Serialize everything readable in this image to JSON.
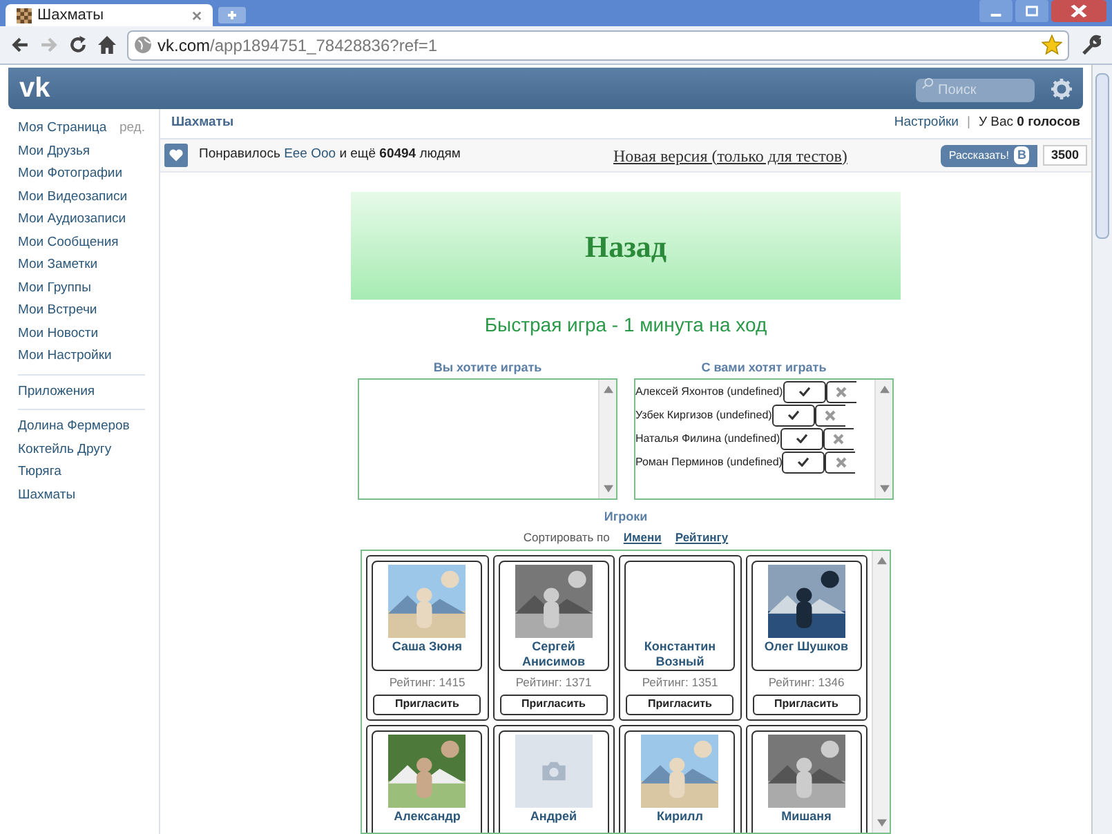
{
  "browser": {
    "tab_title": "Шахматы",
    "url_host": "vk.com",
    "url_path": "/app1894751_78428836?ref=1"
  },
  "header": {
    "logo": "vk",
    "search_placeholder": "Поиск"
  },
  "sidebar": {
    "edit_link": "ред.",
    "groups": [
      {
        "items": [
          "Моя Страница",
          "Мои Друзья",
          "Мои Фотографии",
          "Мои Видеозаписи",
          "Мои Аудиозаписи",
          "Мои Сообщения",
          "Мои Заметки",
          "Мои Группы",
          "Мои Встречи",
          "Мои Новости",
          "Мои Настройки"
        ]
      },
      {
        "items": [
          "Приложения"
        ]
      },
      {
        "items": [
          "Долина Фермеров",
          "Коктейль Другу",
          "Тюряга",
          "Шахматы"
        ]
      }
    ]
  },
  "app_bar": {
    "title": "Шахматы",
    "settings": "Настройки",
    "separator": "|",
    "votes": "У Вас **0 голосов**"
  },
  "like_bar": {
    "liked": "Понравилось ",
    "friend": "Еее Ооо",
    "rest": " и ещё **60494** людям",
    "new_version": "Новая версия (только для тестов)",
    "share": "Рассказать!",
    "vk_badge": "В",
    "count": "3500"
  },
  "game": {
    "back": "Назад",
    "mode": "Быстрая игра - 1 минута на ход",
    "you_want": {
      "title": "Вы хотите играть"
    },
    "want_you": {
      "title": "С вами хотят играть",
      "requests": [
        {
          "name": "Алексей Яхонтов (undefined)"
        },
        {
          "name": "Узбек Киргизов (undefined)"
        },
        {
          "name": "Наталья Филина (undefined)"
        },
        {
          "name": "Роман Перминов (undefined)"
        }
      ]
    },
    "players_title": "Игроки",
    "sort_label": "Сортировать по",
    "sort_options": [
      {
        "label": "Имени"
      },
      {
        "label": "Рейтингу"
      }
    ],
    "players": [
      {
        "kind": "picture",
        "name": "Саша Зюня",
        "rating": "Рейтинг: 1415",
        "invite": "Пригласить"
      },
      {
        "kind": "picture",
        "name": "Сергей Анисимов",
        "rating": "Рейтинг: 1371",
        "invite": "Пригласить"
      },
      {
        "kind": "no_photo",
        "name": "Константин Возный",
        "rating": "Рейтинг: 1351",
        "invite": "Пригласить"
      },
      {
        "kind": "picture",
        "name": "Олег Шушков",
        "rating": "Рейтинг: 1346",
        "invite": "Пригласить"
      },
      {
        "kind": "picture",
        "name": "Александр"
      },
      {
        "kind": "placeholder",
        "name": "Андрей"
      },
      {
        "kind": "picture",
        "name": "Кирилл"
      },
      {
        "kind": "picture",
        "name": "Мишаня"
      }
    ]
  }
}
